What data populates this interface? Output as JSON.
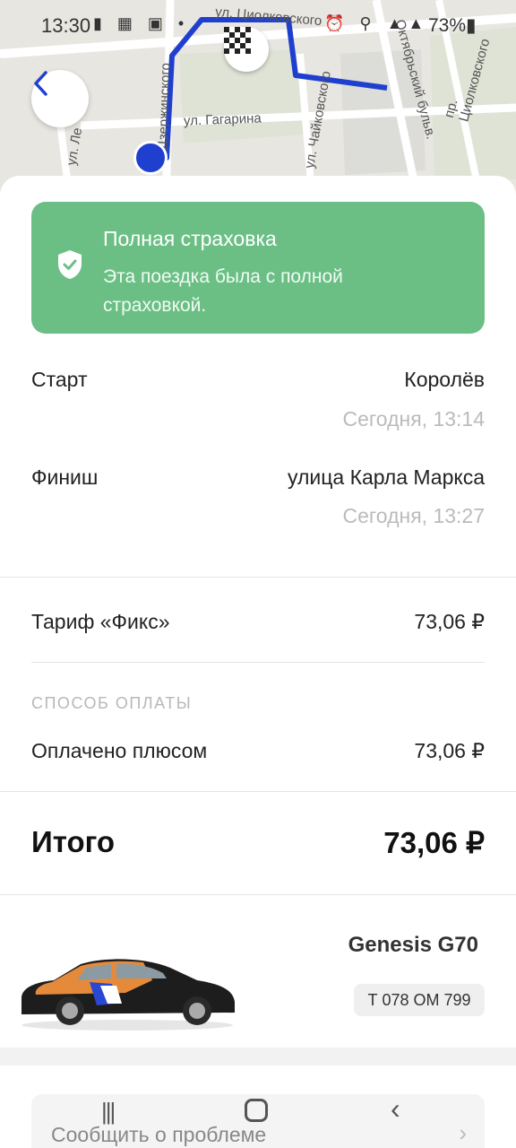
{
  "status_bar": {
    "time": "13:30",
    "left_icons": "▮ ▦ ▣ •",
    "right_icons": "⏰ ⚲ ▲▲",
    "battery": "73%▮"
  },
  "map": {
    "streets": [
      "ул. Циолковского",
      "ул. Гагарина",
      "ул. Чайковского",
      "Октябрьский бульв.",
      "пр. Циолковского",
      "ул. Ле",
      "Дзержинского"
    ]
  },
  "insurance": {
    "title": "Полная страховка",
    "text": "Эта поездка была с полной страховкой."
  },
  "trip": {
    "start_label": "Старт",
    "start_place": "Королёв",
    "start_time": "Сегодня, 13:14",
    "finish_label": "Финиш",
    "finish_place": "улица Карла Маркса",
    "finish_time": "Сегодня, 13:27"
  },
  "pricing": {
    "tariff_label": "Тариф «Фикс»",
    "tariff_value": "73,06 ₽",
    "payment_caption": "СПОСОБ ОПЛАТЫ",
    "payment_label": "Оплачено плюсом",
    "payment_value": "73,06 ₽",
    "total_label": "Итого",
    "total_value": "73,06 ₽"
  },
  "car": {
    "model": "Genesis G70",
    "plate": "Т 078 ОМ 799"
  },
  "report": {
    "label": "Сообщить о проблеме",
    "chevron": "›"
  },
  "navbar": {
    "recent": "|||",
    "back": "‹"
  },
  "colors": {
    "route": "#1f3fcf",
    "insurance_bg": "#6bbf85",
    "accent": "#1f3fcf"
  }
}
